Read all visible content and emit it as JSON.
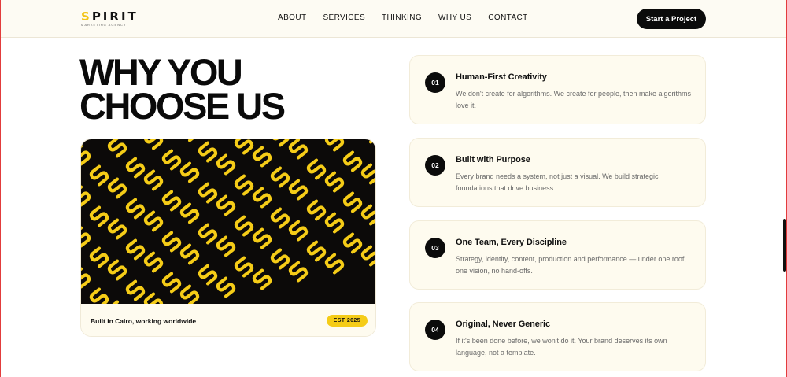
{
  "header": {
    "logo_word_s": "S",
    "logo_word_rest": "PIRIT",
    "logo_tagline": "MARKETING AGENCY",
    "nav": [
      "ABOUT",
      "SERVICES",
      "THINKING",
      "WHY US",
      "CONTACT"
    ],
    "cta_label": "Start a Project"
  },
  "hero": {
    "title_line1": "WHY YOU",
    "title_line2": "CHOOSE US"
  },
  "image_card": {
    "pattern_glyph": "S",
    "caption": "Built in Cairo, working worldwide",
    "badge": "EST 2025"
  },
  "reasons": [
    {
      "number": "01",
      "title": "Human-First Creativity",
      "description": "We don't create for algorithms. We create for people, then make algorithms love it."
    },
    {
      "number": "02",
      "title": "Built with Purpose",
      "description": "Every brand needs a system, not just a visual. We build strategic foundations that drive business."
    },
    {
      "number": "03",
      "title": "One Team, Every Discipline",
      "description": "Strategy, identity, content, production and performance — under one roof, one vision, no hand-offs."
    },
    {
      "number": "04",
      "title": "Original, Never Generic",
      "description": "If it's been done before, we won't do it. Your brand deserves its own language, not a template."
    }
  ],
  "colors": {
    "accent": "#f5cc17",
    "dark": "#0c0a09",
    "card_bg": "#fefbef"
  },
  "icons": {
    "scrollbar": "scrollbar-thumb"
  }
}
